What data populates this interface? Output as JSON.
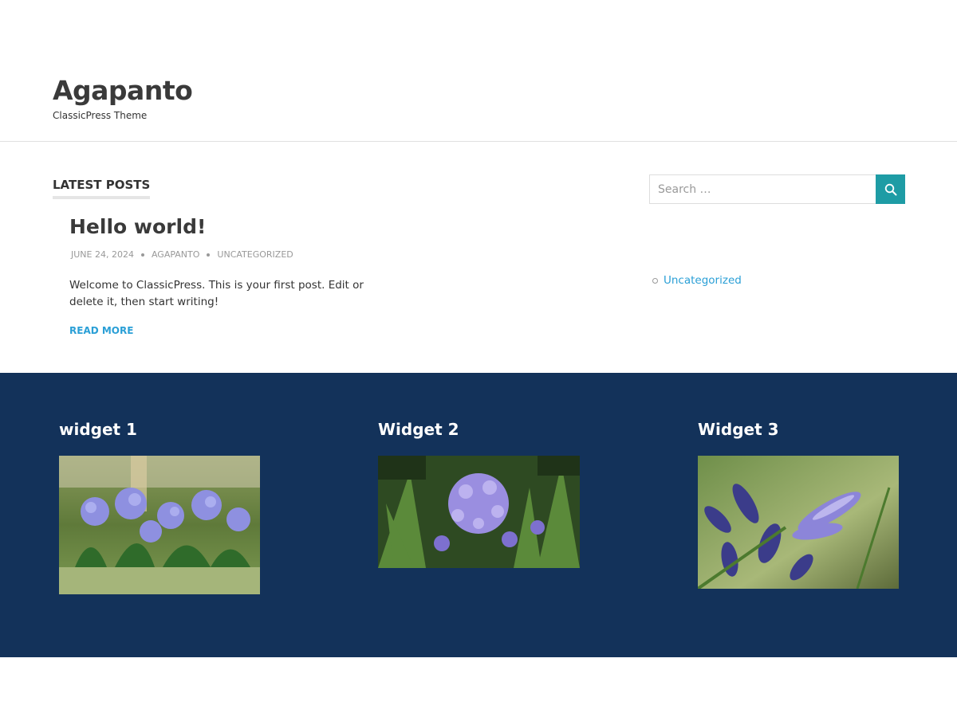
{
  "site": {
    "title": "Agapanto",
    "description": "ClassicPress Theme"
  },
  "main": {
    "section_title": "LATEST POSTS",
    "posts": [
      {
        "title": "Hello world!",
        "date": "JUNE 24, 2024",
        "author": "AGAPANTO",
        "category": "UNCATEGORIZED",
        "excerpt": "Welcome to ClassicPress. This is your first post. Edit or delete it, then start writing!",
        "read_more": "READ MORE"
      }
    ]
  },
  "sidebar": {
    "search": {
      "placeholder": "Search …",
      "button_icon": "search-icon"
    },
    "categories": [
      {
        "label": "Uncategorized"
      }
    ]
  },
  "footer": {
    "widgets": [
      {
        "title": "widget 1",
        "image": "agapanthus-garden-photo"
      },
      {
        "title": "Widget 2",
        "image": "agapanthus-flower-head-photo"
      },
      {
        "title": "Widget 3",
        "image": "agapanthus-buds-closeup-photo"
      }
    ]
  },
  "colors": {
    "accent": "#1e9ca5",
    "link": "#2a9fd6",
    "footer_bg": "#13325a"
  }
}
